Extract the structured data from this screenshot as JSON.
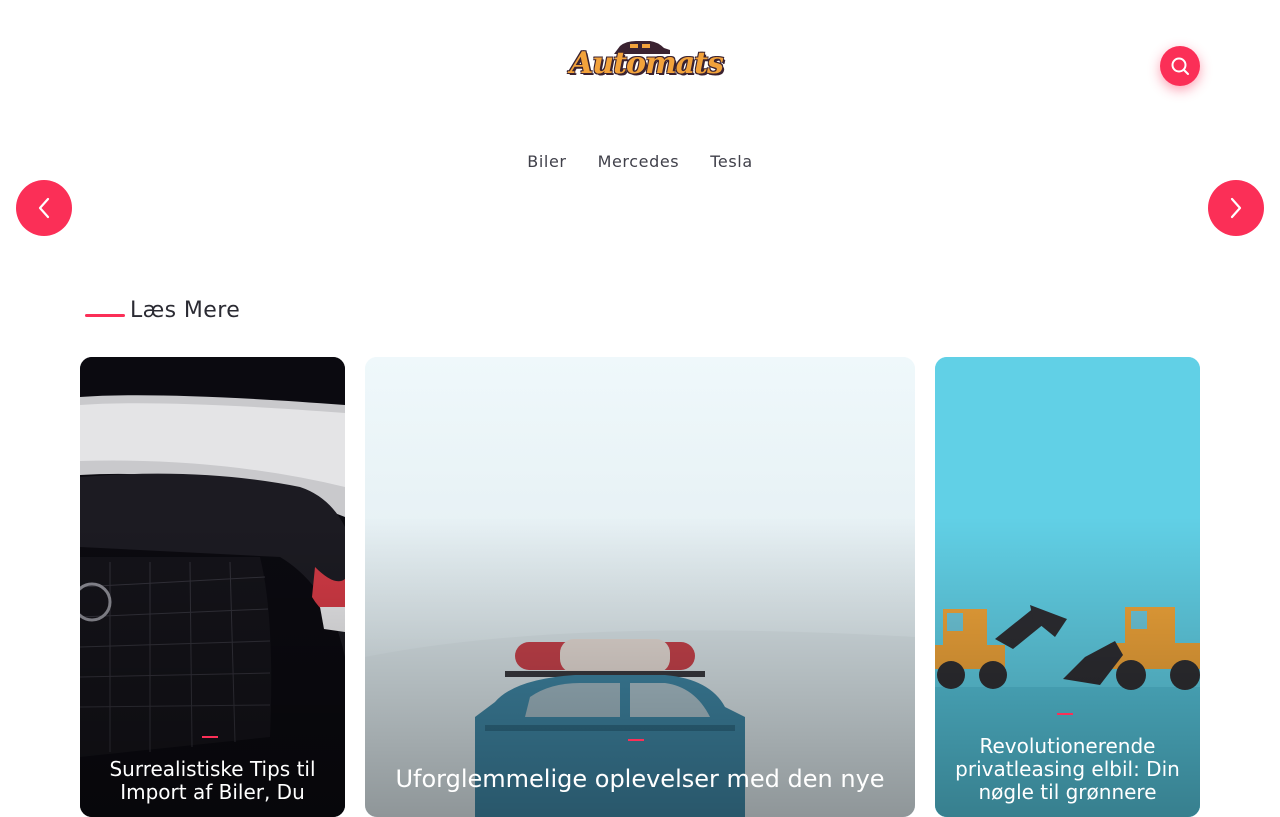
{
  "header": {
    "logo_text": "Automats",
    "search_icon": "search-icon"
  },
  "nav": {
    "items": [
      {
        "label": "Biler"
      },
      {
        "label": "Mercedes"
      },
      {
        "label": "Tesla"
      }
    ]
  },
  "carousel": {
    "prev_icon": "chevron-left-icon",
    "next_icon": "chevron-right-icon"
  },
  "section": {
    "title": "Læs Mere"
  },
  "cards": [
    {
      "title": "Surrealistiske Tips til Import af Biler, Du",
      "image": "car-grille-photo"
    },
    {
      "title": "Uforglemmelige oplevelser med den nye",
      "image": "blue-car-snow-photo"
    },
    {
      "title": "Revolutionerende privatleasing elbil: Din nøgle til grønnere",
      "image": "toy-excavators-photo"
    }
  ],
  "colors": {
    "accent": "#fb2f57",
    "text": "#2b2b33",
    "logo_orange": "#f2a23b"
  }
}
